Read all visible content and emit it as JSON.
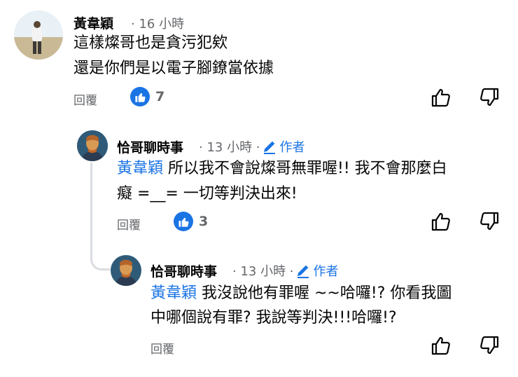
{
  "comments": [
    {
      "author": "黃韋穎",
      "time": "· 16 小時",
      "lines": [
        "這樣燦哥也是貪污犯欸",
        "還是你們是以電子腳鐐當依據"
      ],
      "reply_label": "回覆",
      "reaction_count": "7"
    },
    {
      "author": "恰哥聊時事",
      "time": "· 13 小時 ·",
      "author_badge": "作者",
      "mention": "黃韋穎",
      "line1_rest": " 所以我不會說燦哥無罪喔!! 我不會那麼白",
      "line2": "癡 =__= 一切等判決出來!",
      "reply_label": "回覆",
      "reaction_count": "3"
    },
    {
      "author": "恰哥聊時事",
      "time": "· 13 小時 ·",
      "author_badge": "作者",
      "mention": "黃韋穎",
      "line1_rest": " 我沒說他有罪喔 ~~哈囉!? 你看我圖",
      "line2": "中哪個說有罪? 我說等判決!!!哈囉!?",
      "reply_label": "回覆"
    }
  ],
  "colors": {
    "accent": "#1b74e4",
    "secondary_text": "#65676b",
    "thread_line": "#dadde1"
  },
  "icons": {
    "like": "thumbs-up-icon",
    "dislike": "thumbs-down-icon",
    "author_badge": "pencil-icon",
    "reaction": "like-reaction-icon"
  }
}
